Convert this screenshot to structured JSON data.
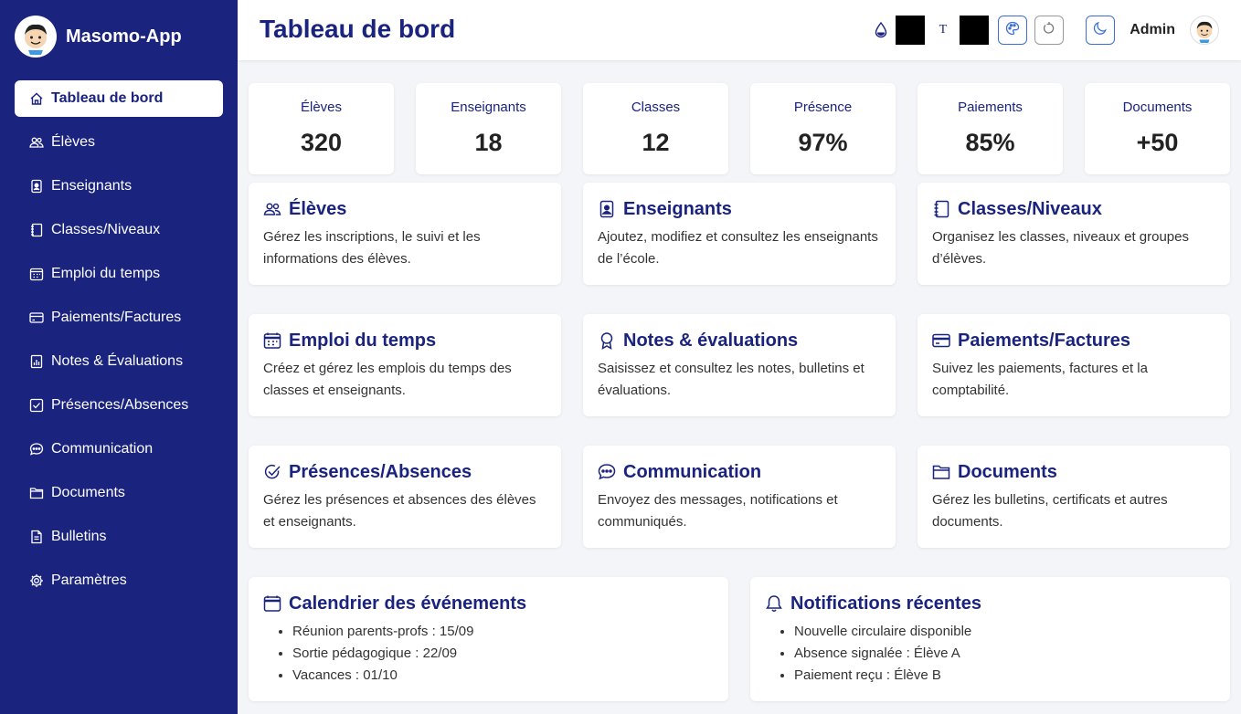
{
  "app": {
    "name": "Masomo-App"
  },
  "sidebar": {
    "items": [
      {
        "label": "Tableau de bord",
        "icon": "home-icon",
        "active": true
      },
      {
        "label": "Élèves",
        "icon": "users-icon"
      },
      {
        "label": "Enseignants",
        "icon": "badge-icon"
      },
      {
        "label": "Classes/Niveaux",
        "icon": "notebook-icon"
      },
      {
        "label": "Emploi du temps",
        "icon": "calendar-week-icon"
      },
      {
        "label": "Paiements/Factures",
        "icon": "credit-card-icon"
      },
      {
        "label": "Notes & Évaluations",
        "icon": "bar-chart-icon"
      },
      {
        "label": "Présences/Absences",
        "icon": "check-square-icon"
      },
      {
        "label": "Communication",
        "icon": "chat-icon"
      },
      {
        "label": "Documents",
        "icon": "folder-icon"
      },
      {
        "label": "Bulletins",
        "icon": "file-icon"
      },
      {
        "label": "Paramètres",
        "icon": "gear-icon"
      }
    ]
  },
  "header": {
    "title": "Tableau de bord",
    "text_tool": "T",
    "user": "Admin"
  },
  "stats": [
    {
      "label": "Élèves",
      "value": "320"
    },
    {
      "label": "Enseignants",
      "value": "18"
    },
    {
      "label": "Classes",
      "value": "12"
    },
    {
      "label": "Présence",
      "value": "97%"
    },
    {
      "label": "Paiements",
      "value": "85%"
    },
    {
      "label": "Documents",
      "value": "+50"
    }
  ],
  "cards": [
    {
      "title": "Élèves",
      "icon": "users-icon",
      "desc": "Gérez les inscriptions, le suivi et les informations des élèves."
    },
    {
      "title": "Enseignants",
      "icon": "badge-icon",
      "desc": "Ajoutez, modifiez et consultez les enseignants de l’école."
    },
    {
      "title": "Classes/Niveaux",
      "icon": "notebook-icon",
      "desc": "Organisez les classes, niveaux et groupes d’élèves."
    },
    {
      "title": "Emploi du temps",
      "icon": "calendar-week-icon",
      "desc": "Créez et gérez les emplois du temps des classes et enseignants."
    },
    {
      "title": "Notes & évaluations",
      "icon": "award-icon",
      "desc": "Saisissez et consultez les notes, bulletins et évaluations."
    },
    {
      "title": "Paiements/Factures",
      "icon": "credit-card-icon",
      "desc": "Suivez les paiements, factures et la comptabilité."
    },
    {
      "title": "Présences/Absences",
      "icon": "check-circle-icon",
      "desc": "Gérez les présences et absences des élèves et enseignants."
    },
    {
      "title": "Communication",
      "icon": "chat-dots-icon",
      "desc": "Envoyez des messages, notifications et communiqués."
    },
    {
      "title": "Documents",
      "icon": "folder-icon",
      "desc": "Gérez les bulletins, certificats et autres documents."
    }
  ],
  "events": {
    "title": "Calendrier des événements",
    "items": [
      "Réunion parents-profs : 15/09",
      "Sortie pédagogique : 22/09",
      "Vacances : 01/10"
    ]
  },
  "notifications": {
    "title": "Notifications récentes",
    "items": [
      "Nouvelle circulaire disponible",
      "Absence signalée : Élève A",
      "Paiement reçu : Élève B"
    ]
  },
  "colors": {
    "primary": "#1a237e",
    "accent": "#3b6fd6",
    "background": "#f4f5f9"
  }
}
